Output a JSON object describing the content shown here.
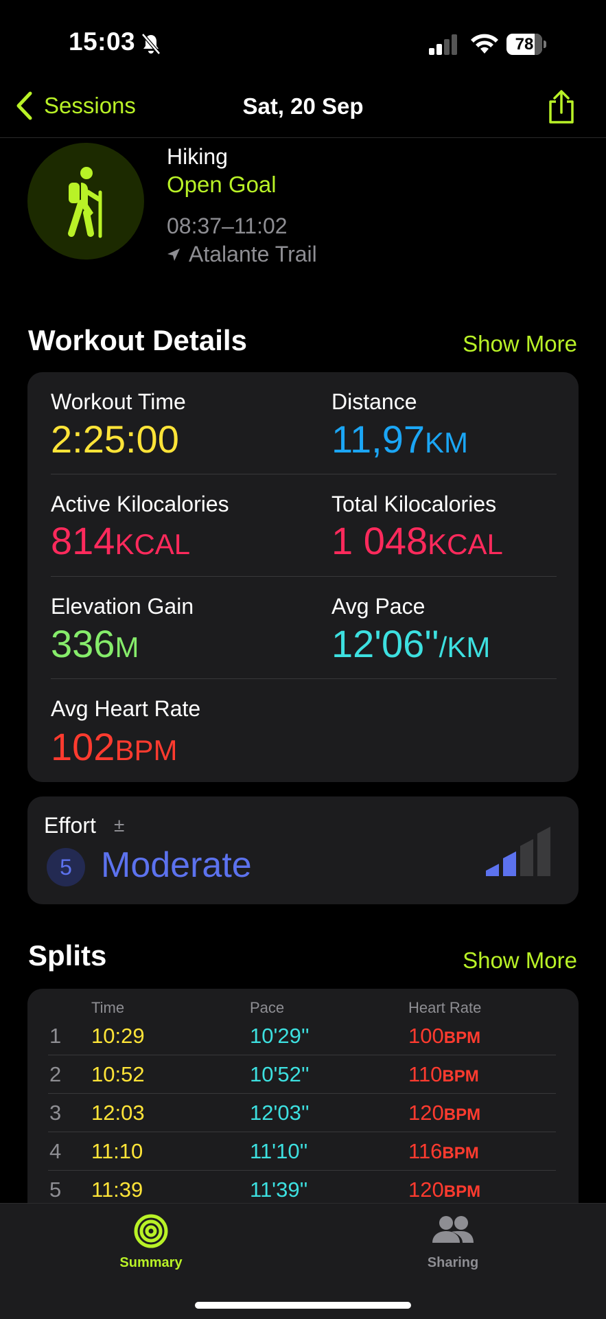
{
  "status_bar": {
    "time": "15:03",
    "battery": "78",
    "battery_level_percent": 78
  },
  "nav": {
    "back_label": "Sessions",
    "title": "Sat, 20 Sep"
  },
  "header": {
    "activity": "Hiking",
    "goal": "Open Goal",
    "time_range": "08:37–11:02",
    "location": "Atalante Trail"
  },
  "details": {
    "title": "Workout Details",
    "show_more": "Show More",
    "workout_time": {
      "label": "Workout Time",
      "value": "2:25:00",
      "unit": ""
    },
    "distance": {
      "label": "Distance",
      "value": "11,97",
      "unit": "KM"
    },
    "active_kcal": {
      "label": "Active Kilocalories",
      "value": "814",
      "unit": "KCAL"
    },
    "total_kcal": {
      "label": "Total Kilocalories",
      "value": "1 048",
      "unit": "KCAL"
    },
    "elevation": {
      "label": "Elevation Gain",
      "value": "336",
      "unit": "M"
    },
    "avg_pace": {
      "label": "Avg Pace",
      "value": "12'06''",
      "unit": "/KM"
    },
    "avg_hr": {
      "label": "Avg Heart Rate",
      "value": "102",
      "unit": "BPM"
    }
  },
  "effort": {
    "label": "Effort",
    "adjust_symbol": "±",
    "number": "5",
    "level_text": "Moderate",
    "bars_filled": 2,
    "bars_total": 4
  },
  "splits": {
    "title": "Splits",
    "show_more": "Show More",
    "headers": {
      "time": "Time",
      "pace": "Pace",
      "hr": "Heart Rate"
    },
    "rows": [
      {
        "num": "1",
        "time": "10:29",
        "pace": "10'29''",
        "hr": "100",
        "unit": "BPM"
      },
      {
        "num": "2",
        "time": "10:52",
        "pace": "10'52''",
        "hr": "110",
        "unit": "BPM"
      },
      {
        "num": "3",
        "time": "12:03",
        "pace": "12'03''",
        "hr": "120",
        "unit": "BPM"
      },
      {
        "num": "4",
        "time": "11:10",
        "pace": "11'10''",
        "hr": "116",
        "unit": "BPM"
      },
      {
        "num": "5",
        "time": "11:39",
        "pace": "11'39''",
        "hr": "120",
        "unit": "BPM"
      }
    ]
  },
  "tabs": {
    "summary": "Summary",
    "sharing": "Sharing"
  },
  "colors": {
    "accent": "#b9f227",
    "time": "#ffe438",
    "distance": "#1ba6f5",
    "calories": "#ff2a5c",
    "elevation": "#86ec6b",
    "pace": "#3de0e0",
    "heart": "#ff3b2f",
    "effort": "#5c72ee"
  }
}
